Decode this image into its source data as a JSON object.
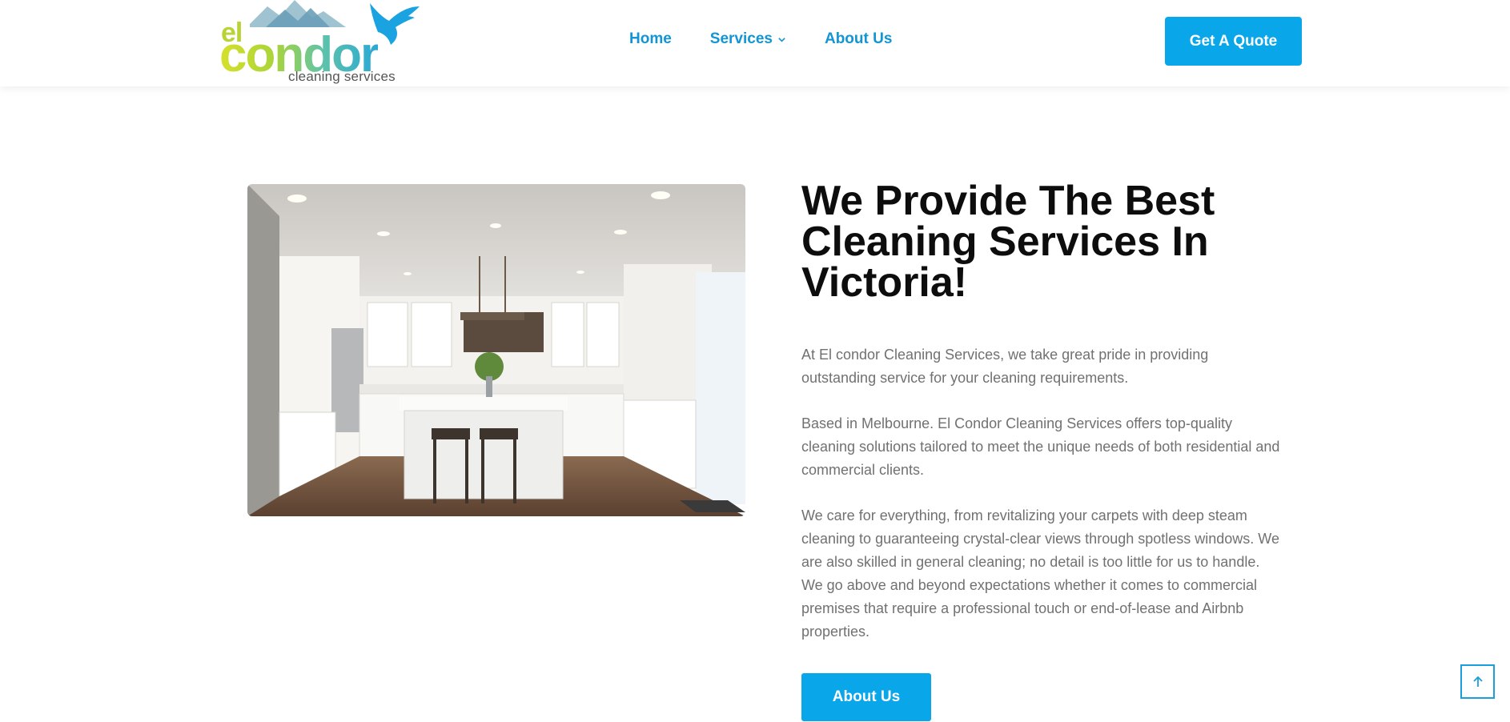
{
  "logo": {
    "word_el": "el",
    "word_condor": "condor",
    "tagline": "cleaning services"
  },
  "nav": {
    "home": "Home",
    "services": "Services",
    "about": "About Us"
  },
  "header": {
    "quote_button": "Get A Quote"
  },
  "main": {
    "image_alt": "Bright white kitchen with island and bar stools",
    "heading": "We Provide The Best Cleaning Services In Victoria!",
    "paragraphs": [
      "At El condor Cleaning Services, we take great pride in providing outstanding service for your cleaning requirements.",
      "Based in Melbourne. El Condor Cleaning Services offers top-quality cleaning solutions tailored to meet the unique needs of both residential and commercial clients.",
      "We care for everything, from revitalizing your carpets with deep steam cleaning to guaranteeing crystal-clear views through spotless windows. We are also skilled in general cleaning; no detail is too little for us to handle. We go above and beyond expectations whether it comes to commercial premises that require a professional touch or end-of-lease and Airbnb properties."
    ],
    "about_button": "About Us"
  },
  "icons": {
    "services_chevron": "chevron-down-icon",
    "back_to_top": "arrow-up-icon",
    "logo_mark": "condor-bird-mountain-icon"
  },
  "colors": {
    "accent": "#0aa6ea",
    "nav_text": "#1495d3",
    "heading": "#0d0d0d",
    "body_text": "#717171"
  }
}
